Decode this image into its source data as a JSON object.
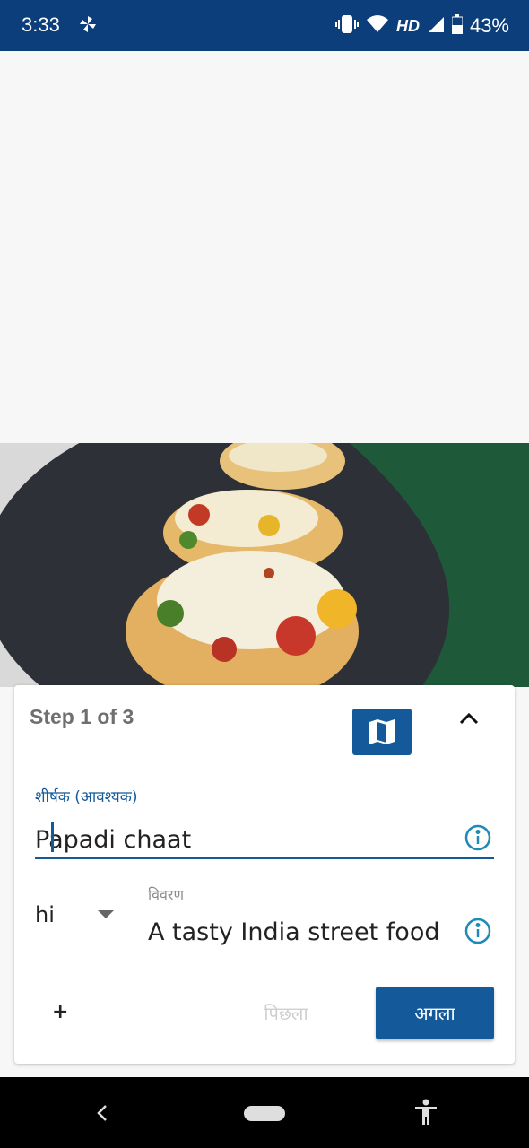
{
  "status_bar": {
    "time": "3:33",
    "network": "HD",
    "battery": "43%"
  },
  "step": {
    "label": "Step 1 of 3"
  },
  "form": {
    "title_label": "शीर्षक (आवश्यक)",
    "title_value": "Papadi chaat",
    "language_value": "hi",
    "description_label": "विवरण",
    "description_value": "A tasty India street food"
  },
  "buttons": {
    "add": "+",
    "previous": "पिछला",
    "next": "अगला"
  },
  "colors": {
    "status_bar": "#0b3e7a",
    "accent": "#145a9b",
    "navbar": "#000000"
  },
  "icons": {
    "status_pin": "pinwheel-icon",
    "map": "map-icon",
    "collapse": "chevron-up-icon",
    "info": "info-icon",
    "dropdown": "caret-down-icon",
    "nav_back": "back-icon",
    "nav_home": "home-pill-icon",
    "nav_access": "accessibility-icon"
  }
}
